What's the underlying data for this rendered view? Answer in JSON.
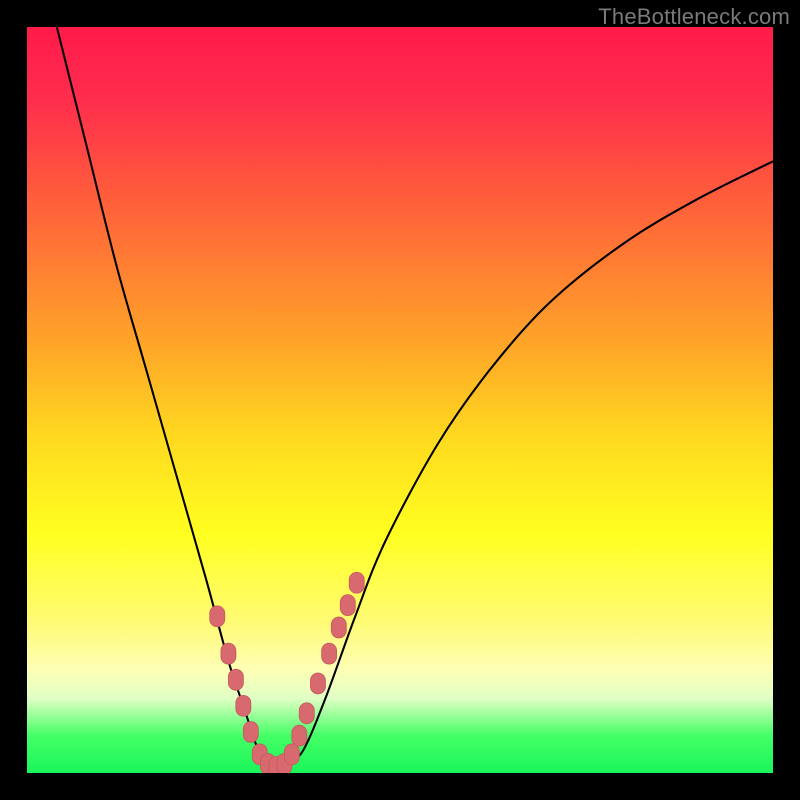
{
  "watermark": "TheBottleneck.com",
  "colors": {
    "background": "#000000",
    "curve": "#000000",
    "marker_fill": "#d86a6f",
    "marker_stroke": "#c95a60",
    "gradient_top": "#ff1a4a",
    "gradient_bottom": "#18f55a"
  },
  "chart_data": {
    "type": "line",
    "title": "",
    "xlabel": "",
    "ylabel": "",
    "xlim": [
      0,
      100
    ],
    "ylim": [
      0,
      100
    ],
    "grid": false,
    "legend": false,
    "series": [
      {
        "name": "bottleneck-curve",
        "x": [
          4,
          8,
          12,
          16,
          20,
          24,
          27,
          29,
          31,
          32,
          33,
          34,
          35,
          37,
          40,
          44,
          48,
          55,
          62,
          70,
          80,
          90,
          100
        ],
        "y": [
          100,
          84,
          68,
          54,
          40,
          26,
          15,
          9,
          3,
          1.5,
          0.8,
          0.8,
          1.5,
          3,
          10,
          21,
          31,
          44,
          54,
          63,
          71,
          77,
          82
        ]
      }
    ],
    "markers": {
      "name": "highlighted-points",
      "style": "round-pink",
      "x": [
        25.5,
        27,
        28,
        29,
        30,
        31.2,
        32.3,
        33.4,
        34.5,
        35.5,
        36.5,
        37.5,
        39,
        40.5,
        41.8,
        43,
        44.2
      ],
      "y": [
        21,
        16,
        12.5,
        9,
        5.5,
        2.5,
        1.2,
        0.8,
        1.2,
        2.5,
        5,
        8,
        12,
        16,
        19.5,
        22.5,
        25.5
      ]
    }
  }
}
